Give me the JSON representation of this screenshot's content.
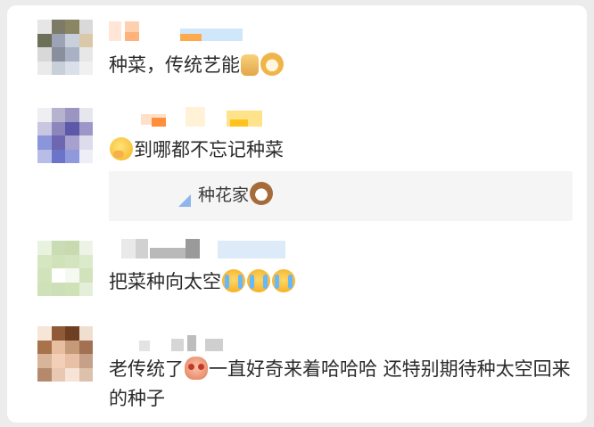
{
  "comments": [
    {
      "text": "种菜，传统艺能",
      "emojis": [
        "thumbs-up-icon",
        "doge-icon"
      ]
    },
    {
      "text": "到哪都不忘记种菜",
      "emojis_before": [
        "shy-face-icon"
      ],
      "reply": {
        "text": "种花家",
        "emojis": [
          "cat-face-icon"
        ]
      }
    },
    {
      "text": "把菜种向太空",
      "emojis": [
        "crying-face-icon",
        "crying-face-icon",
        "crying-face-icon"
      ]
    },
    {
      "text_part1": "老传统了",
      "text_part2": "一直好奇来着哈哈哈 还特别期待种太空回来的种子",
      "emojis": [
        "alien-face-icon"
      ]
    }
  ]
}
